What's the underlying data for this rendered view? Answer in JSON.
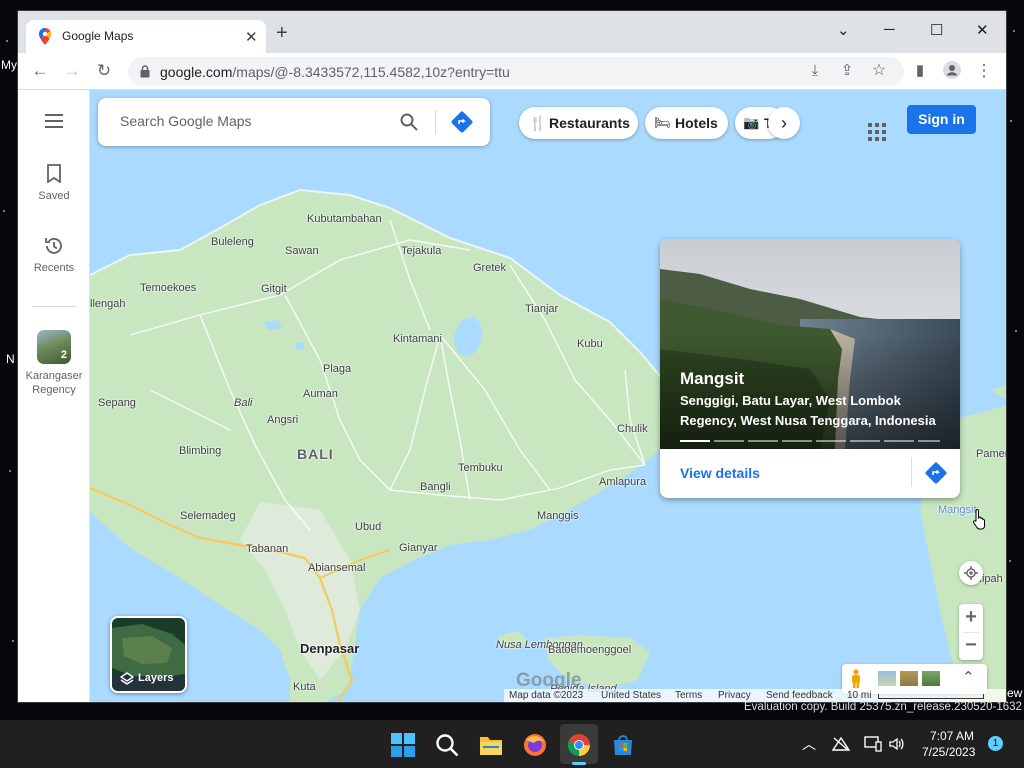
{
  "desktop": {
    "left_text_top": "My",
    "left_text_mid": "N",
    "right_text": "ew"
  },
  "browser": {
    "tab_title": "Google Maps",
    "url_host": "google.com",
    "url_path": "/maps/@-8.3433572,115.4582,10z?entry=ttu"
  },
  "sidebar": {
    "saved_label": "Saved",
    "recents_label": "Recents",
    "recent_item_label": "Karangaser Regency",
    "recent_item_badge": "2"
  },
  "search": {
    "placeholder": "Search Google Maps"
  },
  "chips": [
    {
      "label": "Restaurants",
      "icon": "fork-knife-icon"
    },
    {
      "label": "Hotels",
      "icon": "bed-icon"
    },
    {
      "label": "T",
      "icon": "camera-icon"
    }
  ],
  "header": {
    "signin_label": "Sign in"
  },
  "map": {
    "places": {
      "kubutambahan": "Kubutambahan",
      "buleleng": "Buleleng",
      "sawan": "Sawan",
      "tejakula": "Tejakula",
      "gretek": "Gretek",
      "temoekoes": "Temoekoes",
      "gitgit": "Gitgit",
      "lengah": "llengah",
      "tianjar": "Tianjar",
      "kintamani": "Kintamani",
      "kubu": "Kubu",
      "plaga": "Plaga",
      "auman": "Auman",
      "sepang": "Sepang",
      "bali_ital": "Bali",
      "angsri": "Angsri",
      "chulik": "Chulik",
      "blimbing": "Blimbing",
      "bali": "BALI",
      "tembuku": "Tembuku",
      "amlapura": "Amlapura",
      "bangli": "Bangli",
      "selemadeg": "Selemadeg",
      "manggis": "Manggis",
      "ubud": "Ubud",
      "tabanan": "Tabanan",
      "gianyar": "Gianyar",
      "abiansemal": "Abiansemal",
      "denpasar": "Denpasar",
      "nusa_lembongan": "Nusa Lembongan",
      "batoemoenggoel": "Batoemoenggoel",
      "kuta": "Kuta",
      "penida_island": "Penida Island",
      "mangsit_pin": "Mangsit",
      "pamenang": "Pamenan",
      "nipah": "Nipah"
    }
  },
  "card": {
    "title": "Mangsit",
    "subtitle": "Senggigi, Batu Layar, West Lombok Regency, West Nusa Tenggara, Indonesia",
    "view_details": "View details"
  },
  "layers": {
    "label": "Layers"
  },
  "footer": {
    "map_data": "Map data ©2023",
    "country": "United States",
    "terms": "Terms",
    "privacy": "Privacy",
    "feedback": "Send feedback",
    "scale": "10 mi"
  },
  "watermark": "Google",
  "system": {
    "eval_text": "Evaluation copy. Build 25375.zn_release.230520-1632",
    "time": "7:07 AM",
    "date": "7/25/2023",
    "notification_count": "1"
  }
}
